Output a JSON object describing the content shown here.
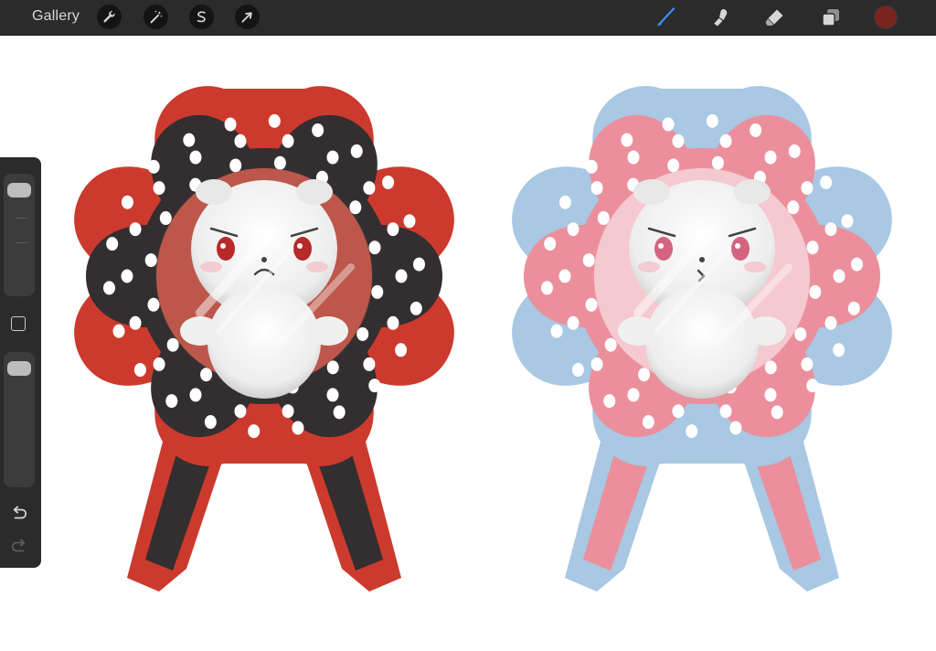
{
  "toolbar": {
    "gallery_label": "Gallery",
    "left_tools": [
      {
        "name": "actions",
        "icon": "wrench-icon"
      },
      {
        "name": "adjustments",
        "icon": "magic-wand-icon"
      },
      {
        "name": "selection",
        "icon": "selection-s-icon"
      },
      {
        "name": "transform",
        "icon": "arrow-cursor-icon"
      }
    ],
    "right_tools": [
      {
        "name": "brush",
        "icon": "brush-icon",
        "active": true
      },
      {
        "name": "smudge",
        "icon": "smudge-finger-icon",
        "active": false
      },
      {
        "name": "eraser",
        "icon": "eraser-icon",
        "active": false
      },
      {
        "name": "layers",
        "icon": "layers-icon",
        "active": false
      }
    ],
    "current_color": "#7a2420",
    "active_tool_color": "#3d8ef7",
    "icon_color": "#d6d6d6"
  },
  "sidebar": {
    "brush_size_level": 0.95,
    "opacity_level": 0.95,
    "modify_icon": "square-modify-icon",
    "undo_icon": "undo-arrow-icon",
    "redo_icon": "redo-arrow-icon"
  },
  "canvas": {
    "artworks": [
      {
        "name": "red-black-rosette",
        "ribbon_colors": [
          "#cc3a2e",
          "#332e2f"
        ],
        "petal_outer_color": "#cc3a2e",
        "petal_inner_color": "#332e2f",
        "dot_color": "#ffffff",
        "dome_tint": "#c04a3d",
        "mascot_eye_color": "#b01818"
      },
      {
        "name": "blue-pink-rosette",
        "ribbon_colors": [
          "#a8c8e4",
          "#ec8f9c"
        ],
        "petal_outer_color": "#a8c8e4",
        "petal_inner_color": "#ec8f9c",
        "dot_color": "#ffffff",
        "dome_tint": "#f6c8cf",
        "mascot_eye_color": "#d05876"
      }
    ]
  }
}
